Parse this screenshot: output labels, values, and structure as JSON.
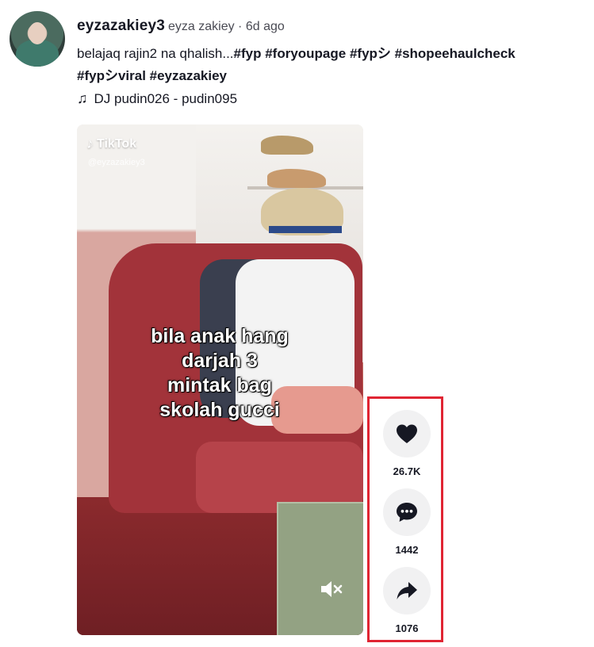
{
  "post": {
    "username": "eyzazakiey3",
    "nickname_time": "eyza zakiey · 6d ago",
    "caption_text": "belajaq rajin2 na qhalish...",
    "hashtags_line1": "#fyp #foryoupage #fypシ #shopeehaulcheck",
    "hashtags_line2": "#fypシviral #eyzazakiey",
    "music": "DJ pudin026 - pudin095"
  },
  "video": {
    "watermark": "TikTok",
    "watermark_handle": "@eyzazakiey3",
    "overlay_line1": "bila anak hang",
    "overlay_line2": "darjah 3",
    "overlay_line3": "mintak bag",
    "overlay_line4": "skolah gucci",
    "muted": true
  },
  "actions": {
    "likes": "26.7K",
    "comments": "1442",
    "shares": "1076"
  },
  "icons": {
    "like": "heart-icon",
    "comment": "comment-bubble-icon",
    "share": "share-arrow-icon",
    "music": "music-note-icon",
    "mute": "volume-muted-icon"
  },
  "colors": {
    "highlight_border": "#e02533",
    "action_bg": "#f1f1f2"
  }
}
